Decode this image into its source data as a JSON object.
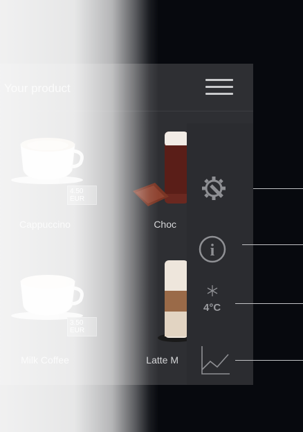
{
  "header": {
    "title": "Your product"
  },
  "products": [
    {
      "name": "Cappuccino",
      "price": "4.50 EUR"
    },
    {
      "name": "Choc",
      "price": ""
    },
    {
      "name": "Milk Coffee",
      "price": "3.50 EUR"
    },
    {
      "name": "Latte M",
      "price": ""
    }
  ],
  "sidebar": {
    "items": [
      {
        "icon": "settings-wrench-gear-icon"
      },
      {
        "icon": "info-icon"
      },
      {
        "icon": "snowflake-icon",
        "temperature": "4°C"
      },
      {
        "icon": "statistics-chart-icon"
      }
    ]
  },
  "colors": {
    "panel": "#2e2f33",
    "sidebar": "#2b2c30",
    "background": "#07090e",
    "text": "#d5d6d8"
  }
}
